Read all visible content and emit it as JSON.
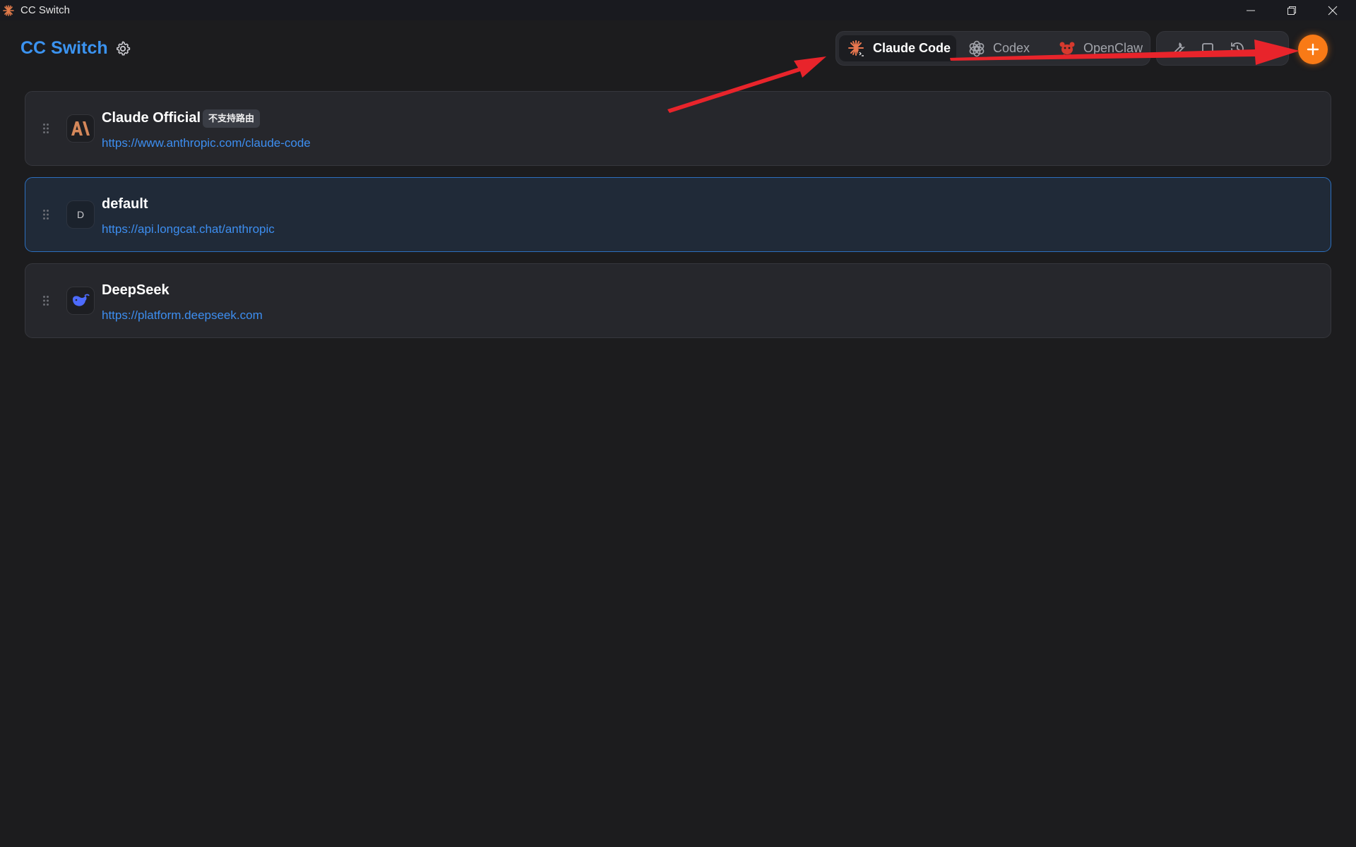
{
  "window": {
    "title": "CC Switch",
    "minimize_icon": "minimize-icon",
    "restore_icon": "restore-icon",
    "close_icon": "close-icon"
  },
  "header": {
    "brand": "CC Switch",
    "settings_icon": "gear-icon",
    "tabs": [
      {
        "label": "Claude Code",
        "icon": "claude-code-icon",
        "active": true
      },
      {
        "label": "Codex",
        "icon": "openai-icon",
        "active": false
      },
      {
        "label": "OpenClaw",
        "icon": "openclaw-icon",
        "active": false
      }
    ],
    "tools": [
      "wrench-icon",
      "square-icon",
      "history-icon"
    ],
    "add_icon": "plus-icon"
  },
  "providers": [
    {
      "name": "Claude Official",
      "badge": "不支持路由",
      "url": "https://www.anthropic.com/claude-code",
      "logo": "anthropic-logo",
      "selected": false
    },
    {
      "name": "default",
      "badge": "",
      "url": "https://api.longcat.chat/anthropic",
      "logo_letter": "D",
      "selected": true
    },
    {
      "name": "DeepSeek",
      "badge": "",
      "url": "https://platform.deepseek.com",
      "logo": "deepseek-logo",
      "selected": false
    }
  ],
  "colors": {
    "background": "#1c1c1e",
    "accent": "#3b93f0",
    "add_button": "#f97a16",
    "annotation_arrow": "#e8242b"
  }
}
